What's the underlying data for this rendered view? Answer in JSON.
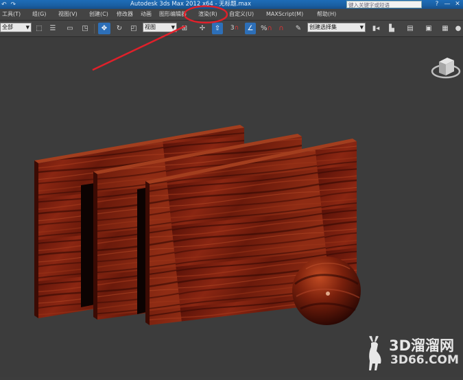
{
  "titlebar": {
    "title": "Autodesk 3ds Max  2012  x64  - 无标题.max",
    "search_placeholder": "键入关键字或短语",
    "quick_access": [
      "↶",
      "↷"
    ],
    "window_buttons": [
      "✕",
      "?",
      "—"
    ]
  },
  "menubar": {
    "items": [
      "工具(T)",
      "组(G)",
      "视图(V)",
      "创建(C)",
      "修改器",
      "动画",
      "图形编辑器",
      "渲染(R)",
      "自定义(U)",
      "MAXScript(M)",
      "帮助(H)"
    ]
  },
  "toolbar": {
    "selection_filter": "全部",
    "reference_coord": "视图",
    "named_selection": "创建选择集",
    "snap_label": "3",
    "percent_label": "%"
  },
  "annotation": {
    "highlight_color": "#e0202a",
    "highlighted_menu": "渲染(R)"
  },
  "watermark": {
    "brand": "3D溜溜网",
    "url": "3D66.COM"
  },
  "viewport": {
    "objects": [
      "wood-panel",
      "wood-panel",
      "wood-panel",
      "wood-sphere"
    ],
    "material": "rosewood",
    "background": "#3c3c3c"
  }
}
